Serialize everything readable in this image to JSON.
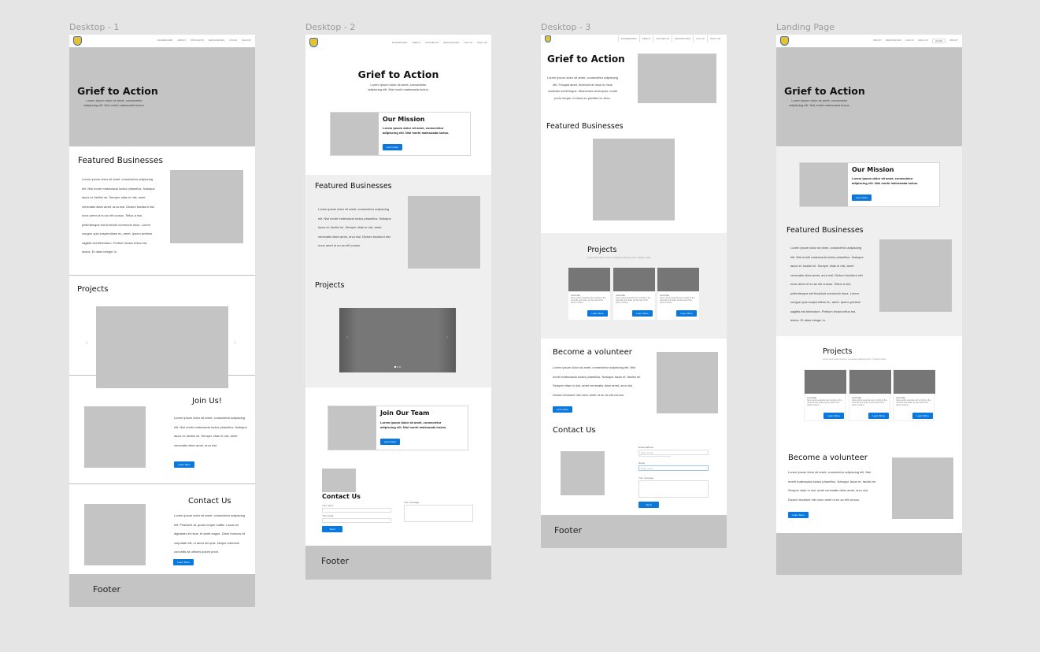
{
  "canvas": {
    "background": "#e5e5e5"
  },
  "colors": {
    "accent": "#0a78dc",
    "placeholder": "#c4c4c4",
    "dark_placeholder": "#767676",
    "section_gray": "#efefef"
  },
  "frames": [
    {
      "label": "Desktop - 1",
      "nav": [
        "DASHBOARD",
        "ABOUT",
        "PROJECTS",
        "RESOURCES",
        "LOGIN",
        "SIGNUP"
      ],
      "hero": {
        "title": "Grief to Action",
        "text": "Lorem ipsum dolor sit amet, consectetur adipiscing elit. Nisl morbi malesuada luctus."
      },
      "featured": {
        "title": "Featured Businesses",
        "text": "Lorem ipsum dolor sit amet, consectetur adipiscing elit. Nisl morbi malesuada luctus phasellus. Natoque lacus et, facilisi mi. Semper vitae in nisl, amet venenatis diam amet, arcu nisl. Dictum tincidunt nisl nunc amet ut eu ac elit cursus. Tellus a nisi, pellentesque est tincidunt commodo risus. Lorem congue quis suspendisse eu, amet. Ipsum pretium sagittis est bibendum. Pretium lectus tellus est, lectus. Et diam integer in."
      },
      "projects": {
        "title": "Projects",
        "prev_icon": "‹",
        "next_icon": "›"
      },
      "join": {
        "title": "Join Us!",
        "text": "Lorem ipsum dolor sit amet, consectetur adipiscing elit. Nisl morbi malesuada luctus phasellus. Natoque lacus et, facilisi mi. Semper vitae in nisl, amet venenatis diam amet, arcu nisl.",
        "button": "Learn More"
      },
      "contact": {
        "title": "Contact Us",
        "text": "Lorem ipsum dolor sit amet, consectetur adipiscing elit. Praesent at, quam neque mattis. Lacus mi dignissim et risus, et amet augue. Diam rhoncus at vulputate elit, in amet vel quis. Neque interdum convallis sit ultrices ipsum proin.",
        "button": "Learn More"
      },
      "footer": "Footer"
    },
    {
      "label": "Desktop - 2",
      "nav": [
        "DASHBOARD",
        "ABOUT",
        "PROJECTS",
        "RESOURCES",
        "LOG IN",
        "SIGN UP"
      ],
      "hero": {
        "title": "Grief to Action",
        "text": "Lorem ipsum dolor sit amet, consectetur adipiscing elit. Nisl morbi malesuada luctus."
      },
      "mission": {
        "title": "Our Mission",
        "text": "Lorem ipsum dolor sit amet, consectetur adipiscing elit. Nisl morbi malesuada luctus.",
        "button": "Learn More"
      },
      "featured": {
        "title": "Featured Businesses",
        "text": "Lorem ipsum dolor sit amet, consectetur adipiscing elit. Nisl morbi malesuada luctus phasellus. Natoque lacus et, facilisi mi. Semper vitae in nisl, amet venenatis diam amet, arcu nisl. Dictum tincidunt nisl nunc amet ut eu ac elit cursus."
      },
      "projects": {
        "title": "Projects",
        "prev_icon": "‹",
        "next_icon": "›",
        "slide_count": 3,
        "active_slide": 1
      },
      "team": {
        "title": "Join Our Team",
        "text": "Lorem ipsum dolor sit amet, consectetur adipiscing elit. Nisl morbi malesuada luctus.",
        "button": "Learn More"
      },
      "contact": {
        "title": "Contact Us",
        "name_label": "Your name",
        "email_label": "Your email",
        "message_label": "Your message",
        "button": "Send"
      },
      "footer": "Footer"
    },
    {
      "label": "Desktop - 3",
      "nav": [
        "DASHBOARD",
        "ABOUT",
        "PROJECTS",
        "RESOURCES",
        "LOG IN",
        "SIGN UP"
      ],
      "hero": {
        "title": "Grief to Action",
        "text": "Lorem ipsum dolor sit amet, consectetur adipiscing elit. Feugiat amet, tincidunt at risus in risus curabitur scelerisque. Maecenas at tempus, morbi proin neque, id risus eu porttitor id. Arcu."
      },
      "featured": {
        "title": "Featured Businesses"
      },
      "projects": {
        "title": "Projects",
        "subtitle": "Lorem ipsum dolor sit amet, consectetur adipiscing elit. In fringilla nullam.",
        "cards": [
          {
            "title": "Card title",
            "text": "Some quick example text to build on the card title and make up the bulk of the card's content.",
            "button": "Learn More"
          },
          {
            "title": "Card title",
            "text": "Some quick example text to build on the card title and make up the bulk of the card's content.",
            "button": "Learn More"
          },
          {
            "title": "Card title",
            "text": "Some quick example text to build on the card title and make up the bulk of the card's content.",
            "button": "Learn More"
          }
        ]
      },
      "volunteer": {
        "title": "Become a volunteer",
        "text": "Lorem ipsum dolor sit amet, consectetur adipiscing elit. Nisi morbi malesuada luctus phasellus. Natoque lacus et, facilisi mi. Semper vitae in nisl, amet venenatis diam amet, arcu nisl. Dictum tincidunt nisl nunc amet ut eu ac elit cursus.",
        "button": "Learn More"
      },
      "contact": {
        "title": "Contact Us",
        "email_label": "Email address",
        "email_placeholder": "Enter email",
        "email_help": "We'll never share your email with anyone else.",
        "name_label": "Name",
        "name_placeholder": "Enter name",
        "message_label": "Your message",
        "button": "Send"
      },
      "footer": "Footer"
    },
    {
      "label": "Landing Page",
      "nav": [
        "ABOUT",
        "RESOURCES",
        "LOG IN",
        "SIGN UP",
        "HOME",
        "ABOUT"
      ],
      "nav_active_index": 4,
      "hero": {
        "title": "Grief to Action",
        "text": "Lorem ipsum dolor sit amet, consectetur adipiscing elit. Nisl morbi malesuada luctus."
      },
      "mission": {
        "title": "Our Mission",
        "text": "Lorem ipsum dolor sit amet, consectetur adipiscing elit. Nisl morbi malesuada luctus.",
        "button": "Learn More"
      },
      "featured": {
        "title": "Featured Businesses",
        "text": "Lorem ipsum dolor sit amet, consectetur adipiscing elit. Nisl morbi malesuada luctus phasellus. Natoque lacus et, facilisi mi. Semper vitae in nisl, amet venenatis diam amet, arcu nisl. Dictum tincidunt nisl nunc amet ut eu ac elit cursus. Tellus a nisi, pellentesque est tincidunt commodo risus. Lorem congue quis suspendisse eu, amet. Ipsum pretium sagittis est bibendum. Pretium lectus tellus est, lectus. Et diam integer in."
      },
      "projects": {
        "title": "Projects",
        "subtitle": "Lorem ipsum dolor sit amet, consectetur adipiscing elit. In fringilla nullam.",
        "cards": [
          {
            "title": "Card title",
            "text": "Some quick example text to build on the card title and make up the bulk of the card's content.",
            "button": "Learn More"
          },
          {
            "title": "Card title",
            "text": "Some quick example text to build on the card title and make up the bulk of the card's content.",
            "button": "Learn More"
          },
          {
            "title": "Card title",
            "text": "Some quick example text to build on the card title and make up the bulk of the card's content.",
            "button": "Learn More"
          }
        ]
      },
      "volunteer": {
        "title": "Become a volunteer",
        "text": "Lorem ipsum dolor sit amet, consectetur adipiscing elit. Nisi morbi malesuada luctus phasellus. Natoque lacus et, facilisi mi. Semper vitae in nisl, amet venenatis diam amet, arcu nisl. Dictum tincidunt nisl nunc amet ut eu ac elit cursus.",
        "button": "Learn More"
      }
    }
  ]
}
